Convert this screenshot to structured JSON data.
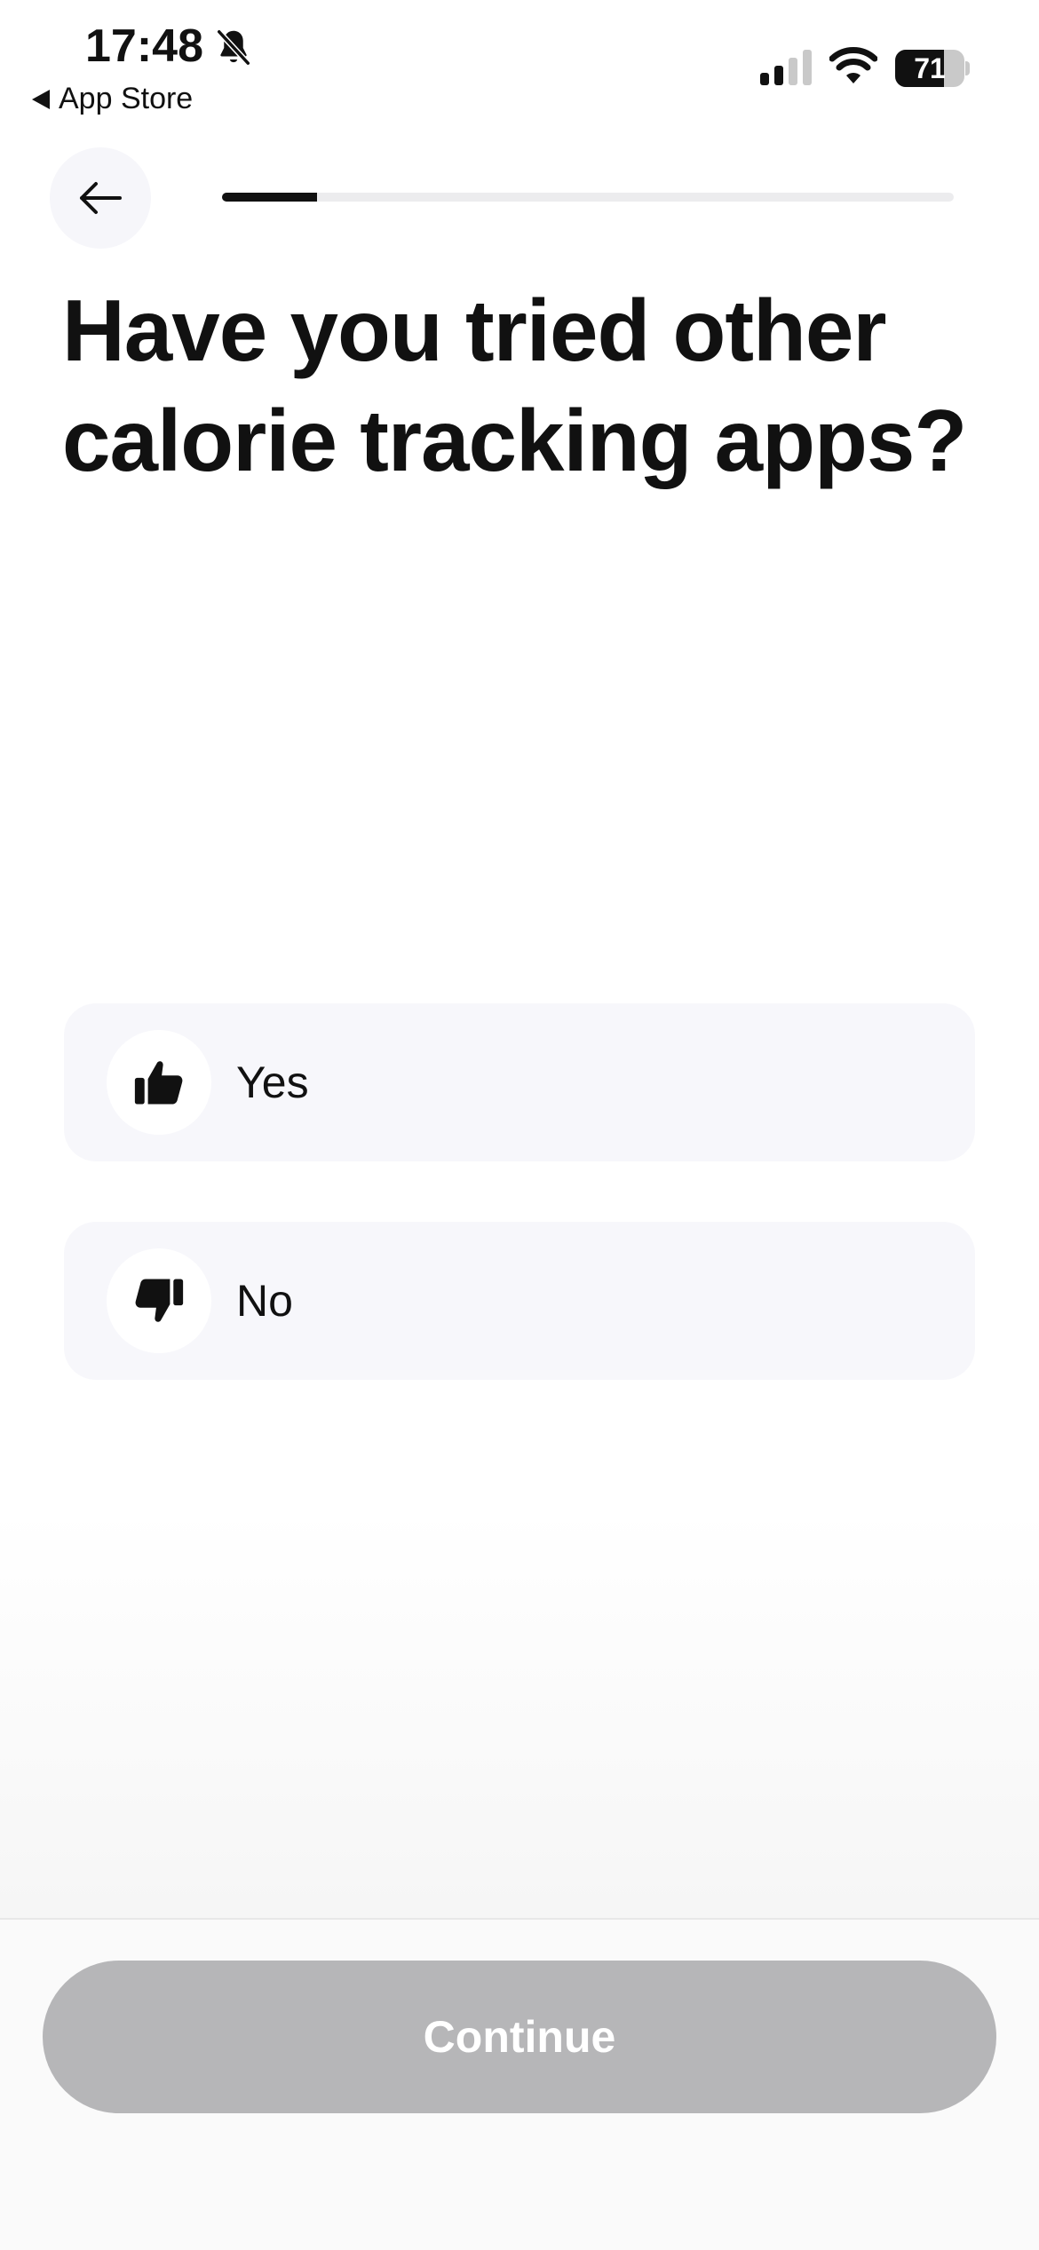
{
  "status_bar": {
    "time": "17:48",
    "back_app_label": "App Store",
    "battery_level": "71",
    "battery_fraction": 0.71,
    "icons": [
      "bell-slash-icon",
      "cellular-signal-icon",
      "wifi-icon",
      "battery-icon"
    ]
  },
  "header": {
    "back_icon": "arrow-left-icon",
    "progress_fraction": 0.13
  },
  "question": {
    "title": "Have you tried other calorie tracking apps?"
  },
  "options": [
    {
      "label": "Yes",
      "icon": "thumbs-up-icon",
      "selected": false
    },
    {
      "label": "No",
      "icon": "thumbs-down-icon",
      "selected": false
    }
  ],
  "footer": {
    "continue_label": "Continue",
    "continue_enabled": false
  },
  "colors": {
    "text": "#111111",
    "option_background": "#f7f7fb",
    "disabled_button": "#b6b6b8",
    "progress_track": "#ececee",
    "progress_fill": "#111111"
  }
}
